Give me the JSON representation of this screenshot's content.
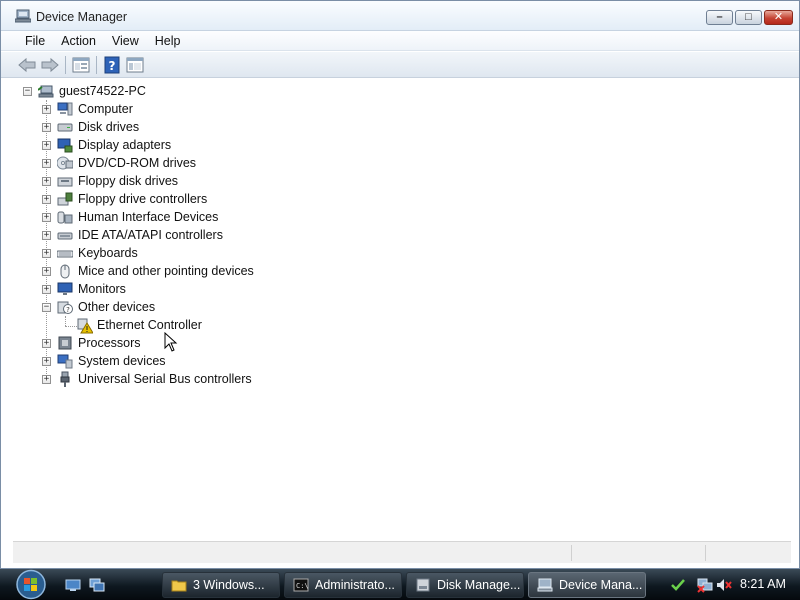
{
  "window": {
    "title": "Device Manager",
    "controls": {
      "minimize": "–",
      "maximize": "□",
      "close": "✕"
    }
  },
  "menu": [
    "File",
    "Action",
    "View",
    "Help"
  ],
  "toolbar": {
    "icons": [
      "back-arrow-icon",
      "forward-arrow-icon",
      "properties-tree-icon",
      "help-icon",
      "view-icon"
    ]
  },
  "tree": {
    "root": {
      "label": "guest74522-PC",
      "icon": "computer-network-icon",
      "expander": "−"
    },
    "items": [
      {
        "label": "Computer",
        "icon": "computer-icon",
        "expander": "+"
      },
      {
        "label": "Disk drives",
        "icon": "disk-drive-icon",
        "expander": "+"
      },
      {
        "label": "Display adapters",
        "icon": "display-adapter-icon",
        "expander": "+"
      },
      {
        "label": "DVD/CD-ROM drives",
        "icon": "dvd-icon",
        "expander": "+"
      },
      {
        "label": "Floppy disk drives",
        "icon": "floppy-icon",
        "expander": "+"
      },
      {
        "label": "Floppy drive controllers",
        "icon": "floppy-controller-icon",
        "expander": "+"
      },
      {
        "label": "Human Interface Devices",
        "icon": "hid-icon",
        "expander": "+"
      },
      {
        "label": "IDE ATA/ATAPI controllers",
        "icon": "ide-icon",
        "expander": "+"
      },
      {
        "label": "Keyboards",
        "icon": "keyboard-icon",
        "expander": "+"
      },
      {
        "label": "Mice and other pointing devices",
        "icon": "mouse-icon",
        "expander": "+"
      },
      {
        "label": "Monitors",
        "icon": "monitor-icon",
        "expander": "+"
      },
      {
        "label": "Other devices",
        "icon": "unknown-device-icon",
        "expander": "−",
        "children": [
          {
            "label": "Ethernet Controller",
            "icon": "warning-device-icon"
          }
        ]
      },
      {
        "label": "Processors",
        "icon": "processor-icon",
        "expander": "+"
      },
      {
        "label": "System devices",
        "icon": "system-device-icon",
        "expander": "+"
      },
      {
        "label": "Universal Serial Bus controllers",
        "icon": "usb-icon",
        "expander": "+"
      }
    ]
  },
  "taskbar": {
    "start_icon": "windows-start-orb-icon",
    "quick_launch": [
      "show-desktop-icon",
      "switch-windows-icon"
    ],
    "tasks": [
      {
        "label": "3 Windows...",
        "icon": "folder-icon",
        "active": false
      },
      {
        "label": "Administrato...",
        "icon": "command-prompt-icon",
        "active": false
      },
      {
        "label": "Disk Manage...",
        "icon": "disk-management-icon",
        "active": false
      },
      {
        "label": "Device Mana...",
        "icon": "device-manager-icon",
        "active": true
      }
    ],
    "tray_icons": [
      "checkmark-icon",
      "network-disconnected-icon",
      "volume-muted-icon"
    ],
    "clock": "8:21 AM"
  },
  "colors": {
    "window_border": "#7a8ea6",
    "close_button": "#c54434",
    "taskbar": "#0e1820",
    "warning": "#e8c200"
  }
}
